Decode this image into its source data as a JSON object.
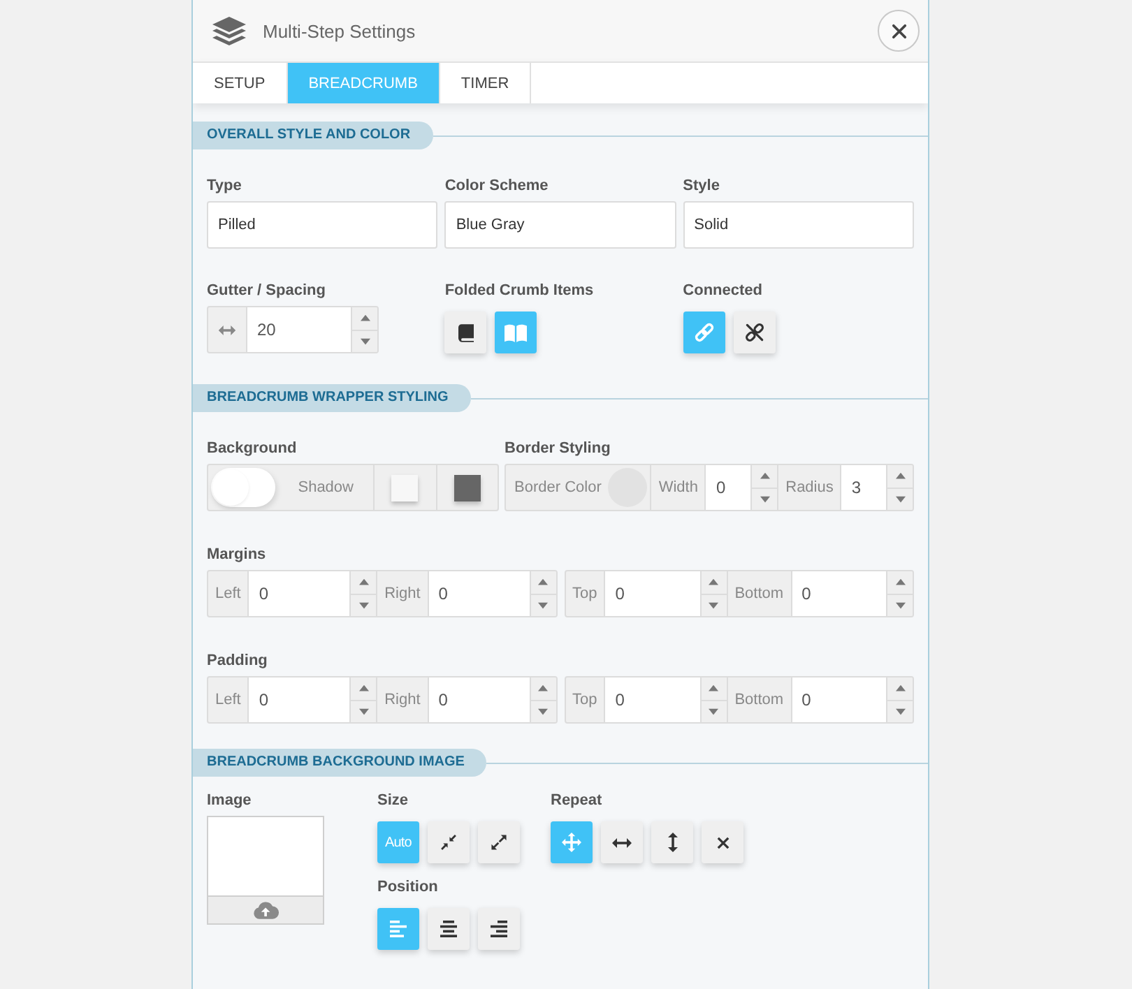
{
  "window": {
    "title": "Multi-Step Settings"
  },
  "tabs": [
    {
      "label": "SETUP",
      "selected": false
    },
    {
      "label": "BREADCRUMB",
      "selected": true
    },
    {
      "label": "TIMER",
      "selected": false
    }
  ],
  "overall_style": {
    "title": "OVERALL STYLE AND COLOR",
    "fields": [
      {
        "label": "Type",
        "value": "Pilled"
      },
      {
        "label": "Color Scheme",
        "value": "Blue Gray"
      },
      {
        "label": "Style",
        "value": "Solid"
      }
    ],
    "gutter": {
      "label": "Gutter / Spacing",
      "value": "20"
    },
    "folded_crumb_items": {
      "label": "Folded Crumb Items",
      "options": [
        {
          "selected": false
        },
        {
          "selected": true
        }
      ]
    },
    "connected": {
      "label": "Connected",
      "options": [
        {
          "selected": true
        },
        {
          "selected": false
        }
      ]
    }
  },
  "wrapper_styling": {
    "title": "BREADCRUMB WRAPPER STYLING",
    "background": {
      "label": "Background",
      "shadow": {
        "label": "Shadow",
        "on": false
      },
      "swatches": [
        {
          "color": "#f7f7f7"
        },
        {
          "color": "#666666"
        }
      ]
    },
    "border": {
      "label": "Border Styling",
      "color_label": "Border Color",
      "color": "#e2e2e2",
      "width": {
        "label": "Width",
        "value": "0"
      },
      "radius": {
        "label": "Radius",
        "value": "3"
      }
    },
    "margins": {
      "label": "Margins",
      "fields": [
        {
          "label": "Left",
          "value": "0"
        },
        {
          "label": "Right",
          "value": "0"
        },
        {
          "label": "Top",
          "value": "0"
        },
        {
          "label": "Bottom",
          "value": "0"
        }
      ]
    },
    "padding": {
      "label": "Padding",
      "fields": [
        {
          "label": "Left",
          "value": "0"
        },
        {
          "label": "Right",
          "value": "0"
        },
        {
          "label": "Top",
          "value": "0"
        },
        {
          "label": "Bottom",
          "value": "0"
        }
      ]
    }
  },
  "background_image": {
    "title": "BREADCRUMB BACKGROUND IMAGE",
    "image": {
      "label": "Image"
    },
    "size": {
      "label": "Size",
      "options": [
        {
          "label": "Auto",
          "selected": true
        },
        {
          "selected": false
        },
        {
          "selected": false
        }
      ]
    },
    "repeat": {
      "label": "Repeat",
      "options": [
        {
          "selected": true
        },
        {
          "selected": false
        },
        {
          "selected": false
        },
        {
          "selected": false
        }
      ]
    },
    "position": {
      "label": "Position",
      "options": [
        {
          "selected": true
        },
        {
          "selected": false
        },
        {
          "selected": false
        }
      ]
    }
  }
}
